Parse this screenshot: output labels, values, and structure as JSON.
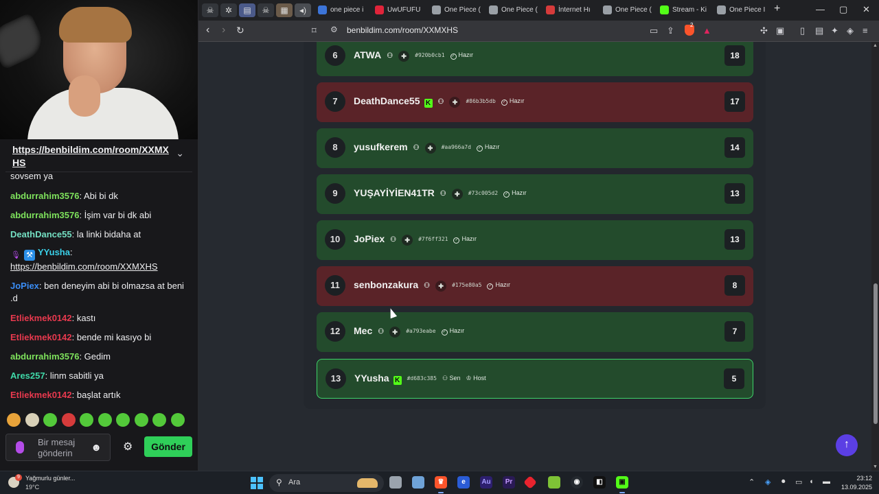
{
  "stream": {
    "pinned_url": "https://benbildim.com/room/XXMXHS",
    "messages": [
      {
        "user": "",
        "text": "sovsem ya",
        "color": "#efeff1"
      },
      {
        "user": "abdurrahim3576",
        "text": "Abi bi dk",
        "color": "#7ee25c"
      },
      {
        "user": "abdurrahim3576",
        "text": "İşim var bi dk abi",
        "color": "#7ee25c"
      },
      {
        "user": "DeathDance55",
        "text": "la linki bidaha at",
        "color": "#74e0c3"
      },
      {
        "user": "YYusha",
        "text": "https://benbildim.com/room/XXMXHS",
        "color": "#3ad0e8"
      },
      {
        "user": "JoPiex",
        "text": "ben deneyim abi bi olmazsa at beni .d",
        "color": "#3a8df6"
      },
      {
        "user": "Etliekmek0142",
        "text": "kastı",
        "color": "#e8394e"
      },
      {
        "user": "Etliekmek0142",
        "text": "bende mi kasıyo bi",
        "color": "#e8394e"
      },
      {
        "user": "abdurrahim3576",
        "text": "Gedim",
        "color": "#7ee25c"
      },
      {
        "user": "Ares257",
        "text": "linm sabitli ya",
        "color": "#3fd9a8"
      },
      {
        "user": "Etliekmek0142",
        "text": "başlat artık",
        "color": "#e8394e"
      }
    ],
    "input_placeholder": "Bir mesaj gönderin",
    "send_label": "Gönder"
  },
  "browser": {
    "pinned_tabs": [
      "pirate-icon",
      "extension-icon",
      "list-icon",
      "pirate-icon",
      "image-icon",
      "audio-icon"
    ],
    "tabs": [
      {
        "title": "one piece i",
        "icon": "streaming-site-icon",
        "color": "#3c74d8"
      },
      {
        "title": "UwUFUFU",
        "icon": "uwufufu-icon",
        "color": "#e0243a"
      },
      {
        "title": "One Piece (",
        "icon": "globe-icon",
        "color": "#9aa0a6"
      },
      {
        "title": "One Piece (",
        "icon": "globe-icon",
        "color": "#9aa0a6"
      },
      {
        "title": "İnternet Hı",
        "icon": "speedtest-icon",
        "color": "#d63b3b"
      },
      {
        "title": "One Piece (",
        "icon": "globe-icon",
        "color": "#9aa0a6"
      },
      {
        "title": "Stream - Ki",
        "icon": "kick-icon",
        "color": "#53fc18"
      },
      {
        "title": "One Piece I",
        "icon": "globe-icon",
        "color": "#9aa0a6"
      }
    ],
    "new_tab": "+",
    "url": "benbildim.com/room/XXMXHS",
    "shield_count": "2"
  },
  "leaderboard": {
    "ready_label": "Hazır",
    "me_label": "Sen",
    "host_label": "Host",
    "players": [
      {
        "rank": "6",
        "name": "ATWA",
        "kick": false,
        "hash": "#920b0cb1",
        "score": "18",
        "state": "ok",
        "me": false
      },
      {
        "rank": "7",
        "name": "DeathDance55",
        "kick": true,
        "hash": "#86b3b5db",
        "score": "17",
        "state": "bad",
        "me": false
      },
      {
        "rank": "8",
        "name": "yusufkerem",
        "kick": false,
        "hash": "#aa966a7d",
        "score": "14",
        "state": "ok",
        "me": false
      },
      {
        "rank": "9",
        "name": "YUŞAYİYİEN41TR",
        "kick": false,
        "hash": "#73c005d2",
        "score": "13",
        "state": "ok",
        "me": false
      },
      {
        "rank": "10",
        "name": "JoPiex",
        "kick": false,
        "hash": "#7f6ff321",
        "score": "13",
        "state": "ok",
        "me": false
      },
      {
        "rank": "11",
        "name": "senbonzakura",
        "kick": false,
        "hash": "#175e80a5",
        "score": "8",
        "state": "bad",
        "me": false
      },
      {
        "rank": "12",
        "name": "Mec",
        "kick": false,
        "hash": "#a793eabe",
        "score": "7",
        "state": "ok",
        "me": false
      },
      {
        "rank": "13",
        "name": "YYusha",
        "kick": true,
        "hash": "#d683c385",
        "score": "5",
        "state": "me",
        "me": true
      }
    ]
  },
  "taskbar": {
    "weather_text": "Yağmurlu günler...",
    "weather_temp": "19°C",
    "weather_badge": "9",
    "search_label": "Ara",
    "time": "23:12",
    "date": "13.09.2025"
  },
  "colors": {
    "row_ready": "#234b2c",
    "row_not_ready": "#5a2328",
    "accent_green": "#2fcf59",
    "kick_green": "#53fc18",
    "scroll_top": "#5b3fe4"
  }
}
